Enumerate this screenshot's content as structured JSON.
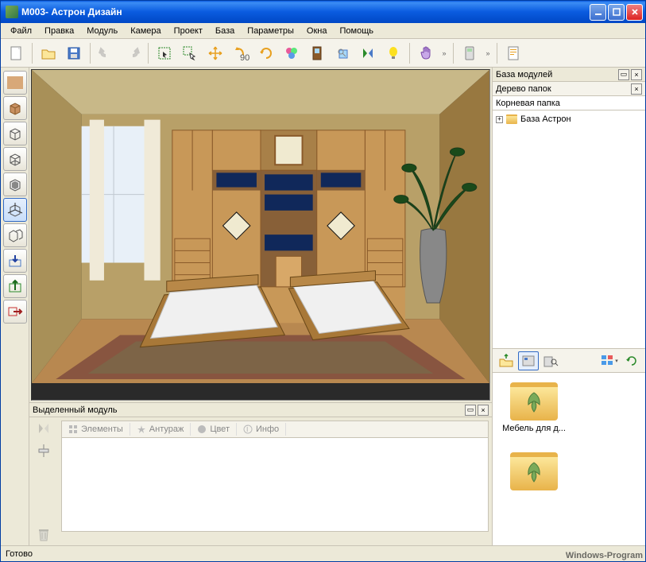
{
  "title": "М003- Астрон Дизайн",
  "menu": [
    "Файл",
    "Правка",
    "Модуль",
    "Камера",
    "Проект",
    "База",
    "Параметры",
    "Окна",
    "Помощь"
  ],
  "selected_panel": {
    "title": "Выделенный модуль",
    "tabs": [
      "Элементы",
      "Антураж",
      "Цвет",
      "Инфо"
    ]
  },
  "right": {
    "modules_title": "База модулей",
    "tree_title": "Дерево папок",
    "root_label": "Корневая папка",
    "tree_items": [
      "База Астрон"
    ],
    "folders": [
      "Мебель для д..."
    ]
  },
  "status": "Готово",
  "watermark": "Windows-Program"
}
